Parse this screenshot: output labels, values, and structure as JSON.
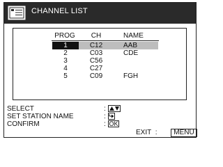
{
  "title": "CHANNEL LIST",
  "icons": {
    "menu": "menu-screen-icon",
    "select": "up-down-arrows-icon",
    "set_name": "enter-arrow-icon"
  },
  "colors": {
    "title_bar": "#2a2a2a",
    "selected_prog": "#111111",
    "selected_row": "#bdbdbd"
  },
  "table": {
    "headers": {
      "prog": "PROG",
      "ch": "CH",
      "name": "NAME"
    },
    "rows": [
      {
        "prog": "1",
        "ch": "C12",
        "name": "AAB",
        "selected": true
      },
      {
        "prog": "2",
        "ch": "C03",
        "name": "CDE",
        "selected": false
      },
      {
        "prog": "3",
        "ch": "C56",
        "name": "",
        "selected": false
      },
      {
        "prog": "4",
        "ch": "C27",
        "name": "",
        "selected": false
      },
      {
        "prog": "5",
        "ch": "C09",
        "name": "FGH",
        "selected": false
      }
    ]
  },
  "help": {
    "select": "SELECT",
    "set_station_name": "SET STATION NAME",
    "confirm": "CONFIRM",
    "separator": ":",
    "ok_key": "OK",
    "exit": "EXIT",
    "exit_separator": ":",
    "menu_key": "MENU"
  }
}
